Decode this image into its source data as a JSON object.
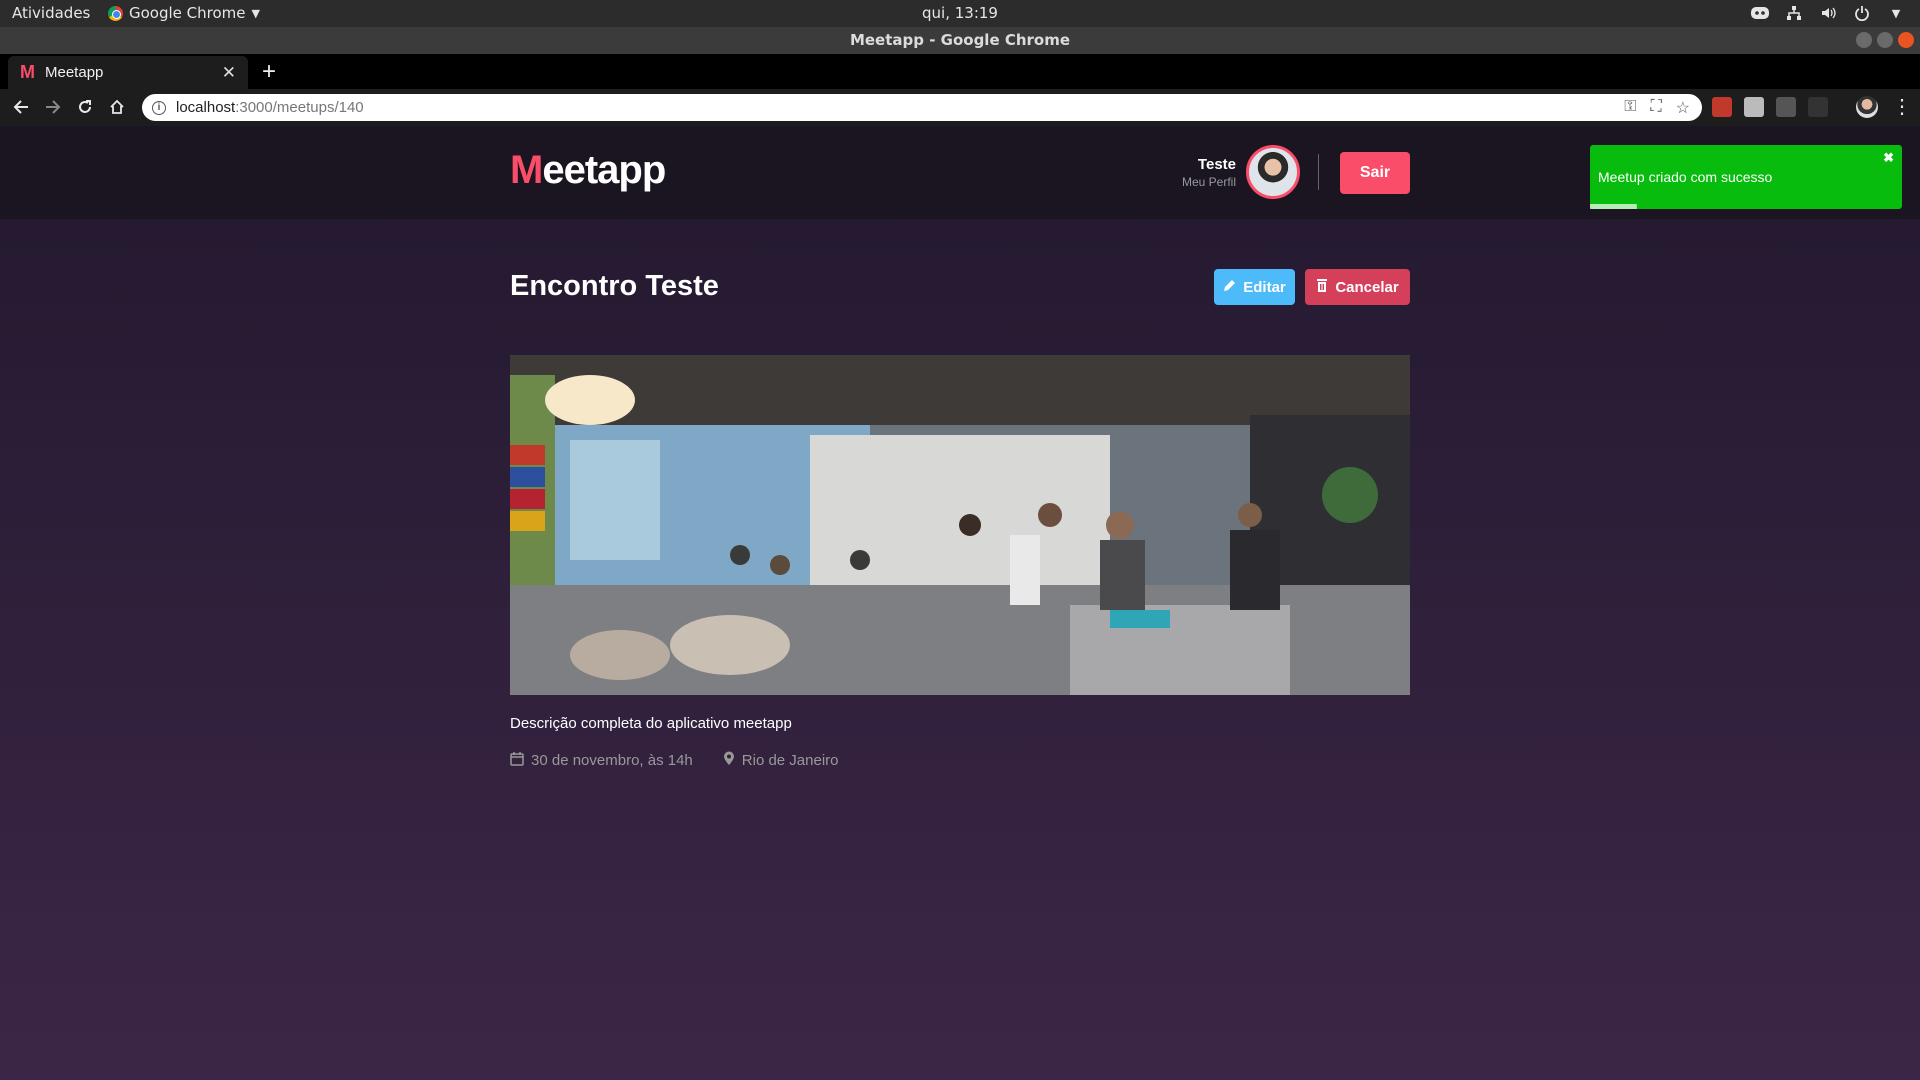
{
  "os": {
    "activities": "Atividades",
    "app_name": "Google Chrome",
    "clock": "qui, 13:19"
  },
  "window": {
    "title": "Meetapp - Google Chrome"
  },
  "tab": {
    "title": "Meetapp",
    "favicon": "M"
  },
  "address": {
    "host": "localhost",
    "path": ":3000/meetups/140"
  },
  "header": {
    "logo_first": "M",
    "logo_rest": "eetapp",
    "user_name": "Teste",
    "profile_link": "Meu Perfil",
    "logout_label": "Sair"
  },
  "toast": {
    "message": "Meetup criado com sucesso",
    "close": "✖",
    "progress": 0.15
  },
  "meetup": {
    "title": "Encontro Teste",
    "edit_label": "Editar",
    "cancel_label": "Cancelar",
    "description": "Descrição completa do aplicativo meetapp",
    "date": "30 de novembro, às 14h",
    "location": "Rio de Janeiro"
  },
  "colors": {
    "accent": "#f94d6a",
    "edit": "#4dbaf9",
    "cancel": "#d44059",
    "toast": "#07bc0c"
  }
}
